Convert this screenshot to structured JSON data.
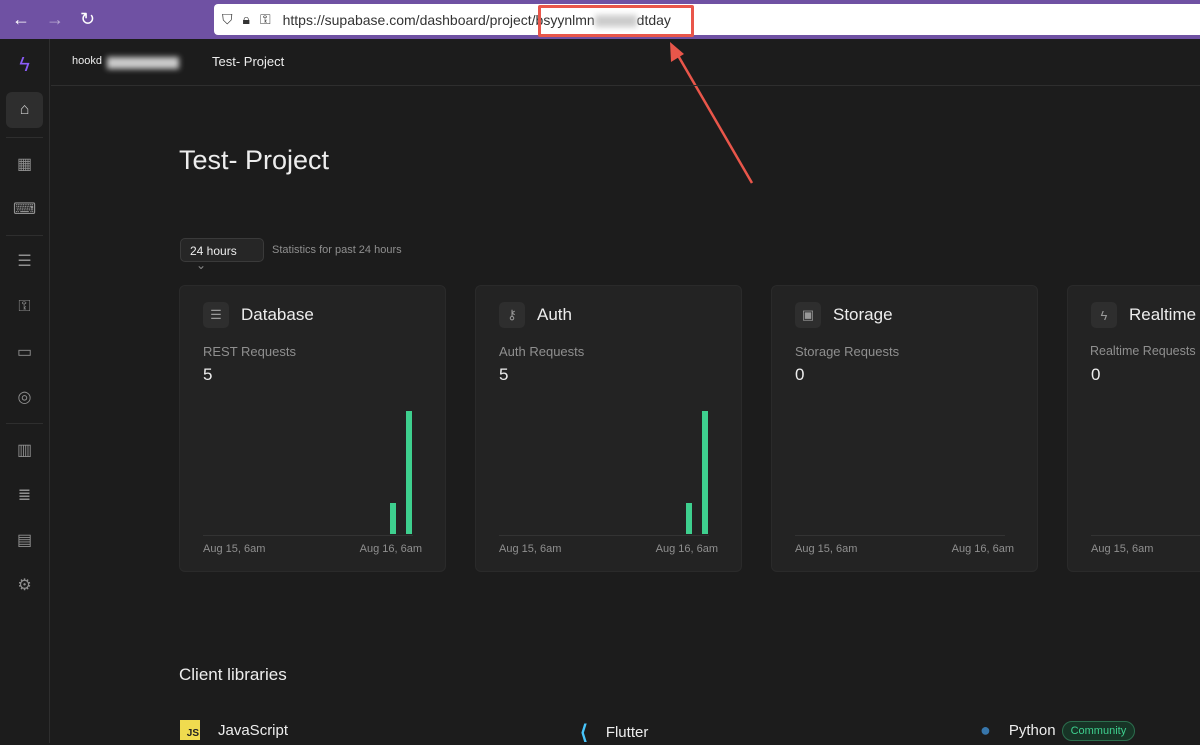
{
  "browser": {
    "url": "https://supabase.com/dashboard/project/bsyynlmn",
    "url_suffix": "dtday"
  },
  "topbar": {
    "org": "hookd",
    "project": "Test- Project"
  },
  "page": {
    "title": "Test- Project",
    "range": "24 hours",
    "range_desc": "Statistics for past 24 hours"
  },
  "cards": [
    {
      "name": "Database",
      "label": "REST Requests",
      "value": "5",
      "icon": "database-icon",
      "start": "Aug 15, 6am",
      "end": "Aug 16, 6am",
      "bars": [
        1,
        4
      ]
    },
    {
      "name": "Auth",
      "label": "Auth Requests",
      "value": "5",
      "icon": "key-icon",
      "start": "Aug 15, 6am",
      "end": "Aug 16, 6am",
      "bars": [
        1,
        4
      ]
    },
    {
      "name": "Storage",
      "label": "Storage Requests",
      "value": "0",
      "icon": "archive-icon",
      "start": "Aug 15, 6am",
      "end": "Aug 16, 6am",
      "bars": []
    },
    {
      "name": "Realtime",
      "label": "Realtime Requests",
      "value": "0",
      "icon": "bolt-icon",
      "start": "Aug 15, 6am",
      "end": "",
      "bars": []
    }
  ],
  "client_libraries": {
    "title": "Client libraries",
    "items": [
      {
        "name": "JavaScript"
      },
      {
        "name": "Flutter"
      },
      {
        "name": "Python",
        "badge": "Community"
      }
    ]
  },
  "colors": {
    "accent": "#3ecf8e",
    "browser": "#6f51a3",
    "highlight": "#e9564a"
  }
}
